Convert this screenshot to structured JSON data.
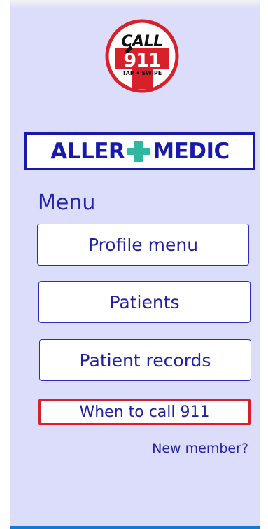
{
  "logo": {
    "call_text": "CALL",
    "number_text": "911",
    "tagline": "TAP • SWIPE",
    "colors": {
      "ring": "#d8202a",
      "cross": "#d8202a",
      "circle_bg": "#ffffff"
    }
  },
  "brand": {
    "left_text": "ALLER",
    "right_text": "MEDIC",
    "icon": "medical-cross-icon",
    "colors": {
      "text": "#1a1aa8",
      "cross": "#2fb8a0"
    }
  },
  "menu": {
    "title": "Menu",
    "buttons": [
      {
        "label": "Profile menu"
      },
      {
        "label": "Patients"
      },
      {
        "label": "Patient records"
      }
    ],
    "emergency_button": {
      "label": "When to call 911",
      "border_color": "#d8202a"
    }
  },
  "footer_link": {
    "label": "New member?"
  },
  "colors": {
    "background": "#dcdcfb",
    "accent": "#22229e",
    "bottom_bar": "#0f7bd6"
  }
}
